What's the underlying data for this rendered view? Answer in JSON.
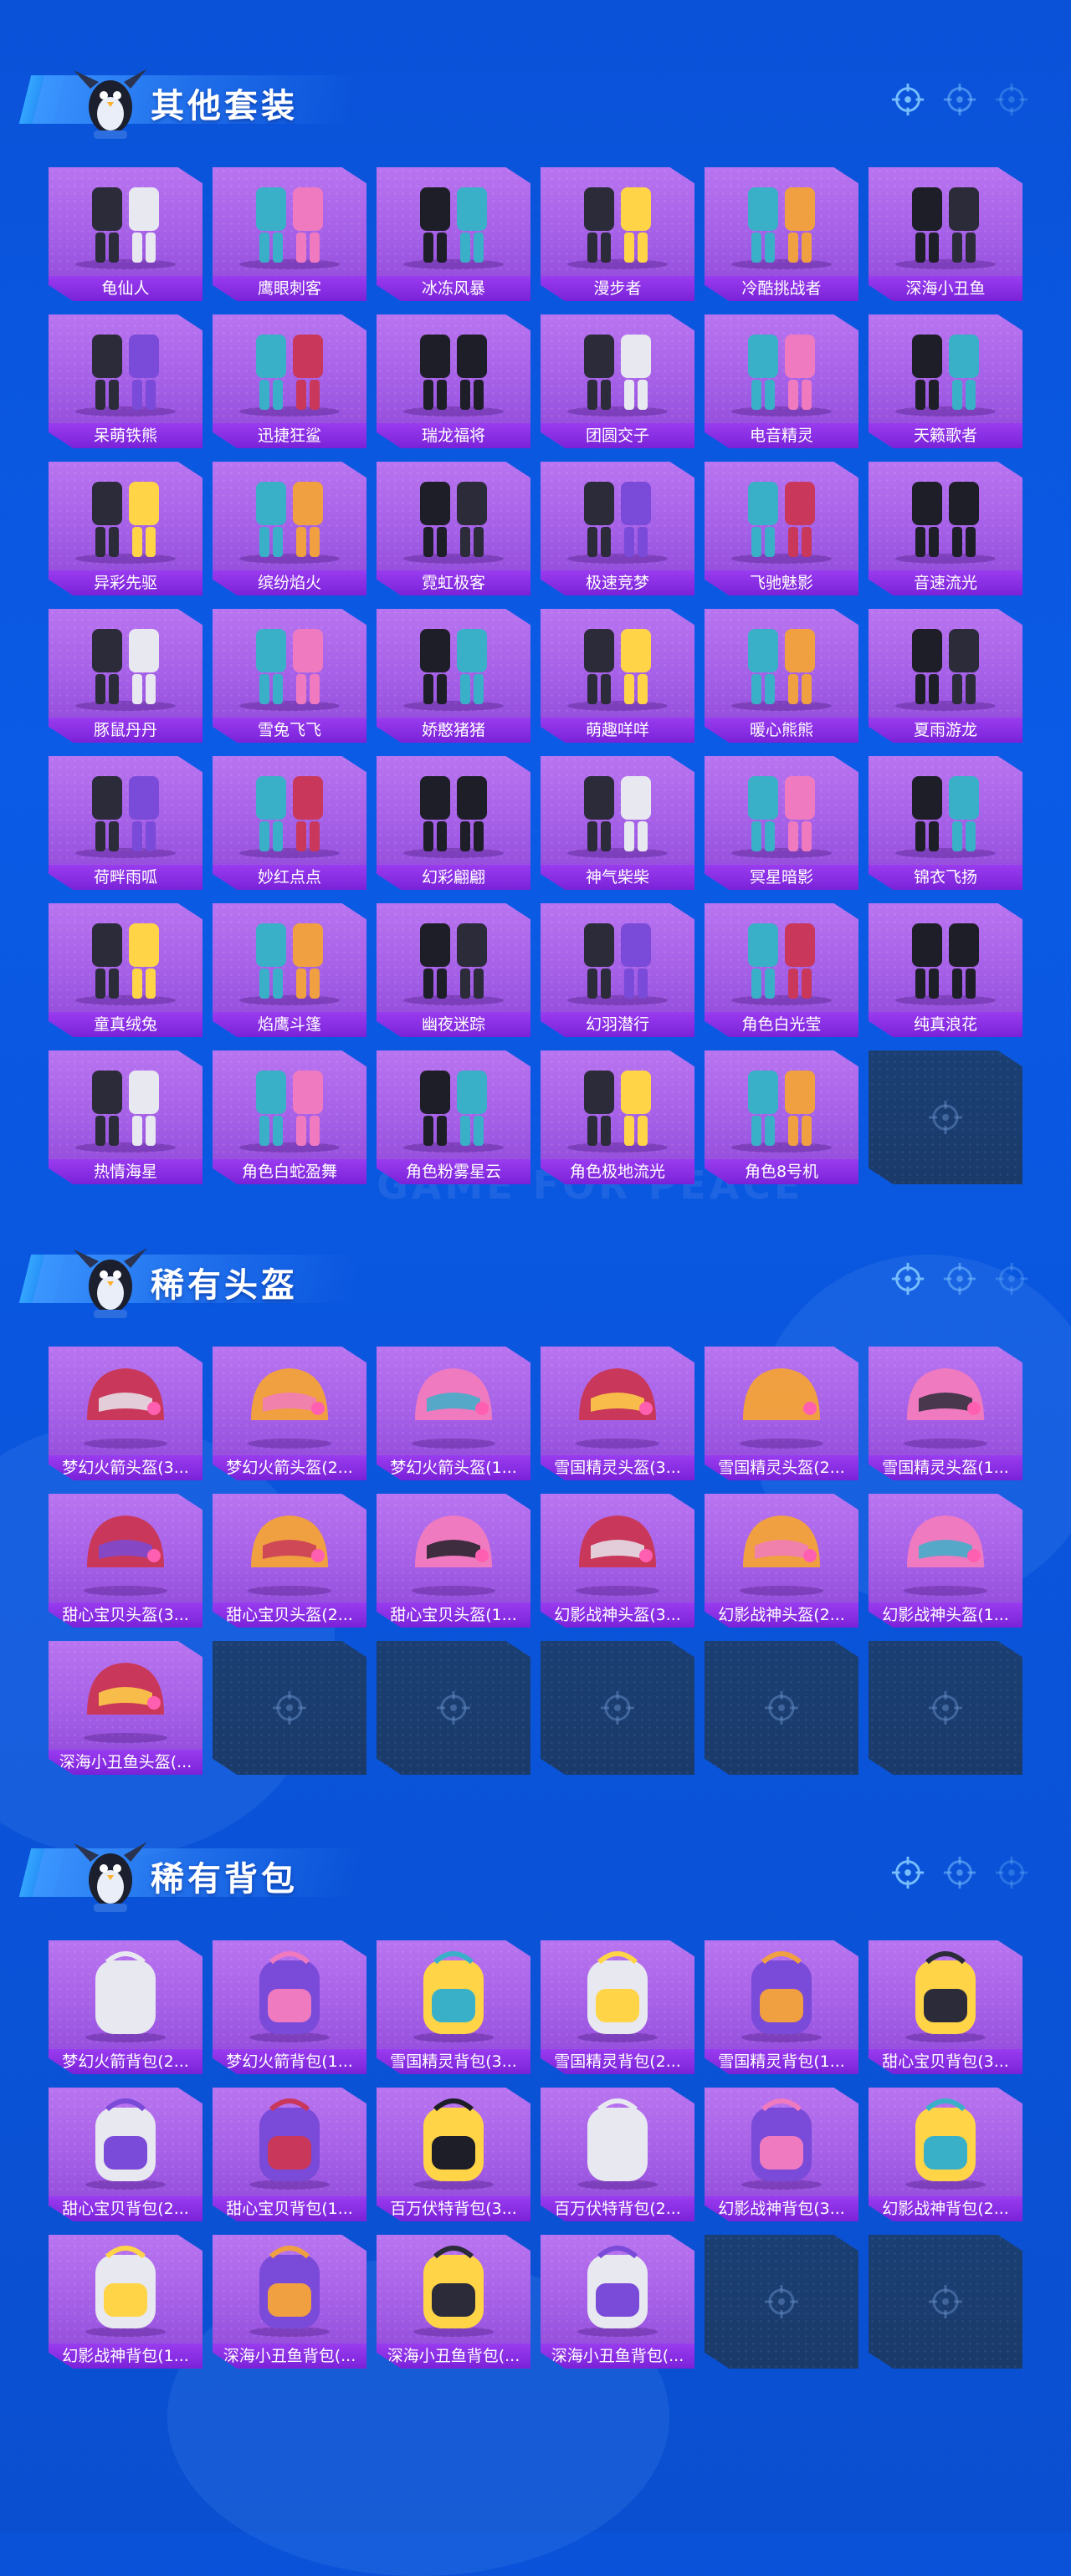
{
  "watermark": "GAME FOR PEACE",
  "sections": [
    {
      "title": "其他套装",
      "items": [
        "龟仙人",
        "鹰眼刺客",
        "冰冻风暴",
        "漫步者",
        "冷酷挑战者",
        "深海小丑鱼",
        "呆萌铁熊",
        "迅捷狂鲨",
        "瑞龙福将",
        "团圆交子",
        "电音精灵",
        "天籁歌者",
        "异彩先驱",
        "缤纷焰火",
        "霓虹极客",
        "极速竞梦",
        "飞驰魅影",
        "音速流光",
        "豚鼠丹丹",
        "雪兔飞飞",
        "娇憨猪猪",
        "萌趣咩咩",
        "暖心熊熊",
        "夏雨游龙",
        "荷畔雨呱",
        "妙红点点",
        "幻彩翩翩",
        "神气柴柴",
        "冥星暗影",
        "锦衣飞扬",
        "童真绒兔",
        "焰鹰斗篷",
        "幽夜迷踪",
        "幻羽潜行",
        "角色白光莹",
        "纯真浪花",
        "热情海星",
        "角色白蛇盈舞",
        "角色粉雾星云",
        "角色极地流光",
        "角色8号机"
      ],
      "empty_count": 1
    },
    {
      "title": "稀有头盔",
      "items": [
        "梦幻火箭头盔(3...",
        "梦幻火箭头盔(2...",
        "梦幻火箭头盔(1...",
        "雪国精灵头盔(3...",
        "雪国精灵头盔(2...",
        "雪国精灵头盔(1...",
        "甜心宝贝头盔(3...",
        "甜心宝贝头盔(2...",
        "甜心宝贝头盔(1...",
        "幻影战神头盔(3...",
        "幻影战神头盔(2...",
        "幻影战神头盔(1...",
        "深海小丑鱼头盔(..."
      ],
      "empty_count": 5
    },
    {
      "title": "稀有背包",
      "items": [
        "梦幻火箭背包(2...",
        "梦幻火箭背包(1...",
        "雪国精灵背包(3...",
        "雪国精灵背包(2...",
        "雪国精灵背包(1...",
        "甜心宝贝背包(3...",
        "甜心宝贝背包(2...",
        "甜心宝贝背包(1...",
        "百万伏特背包(3...",
        "百万伏特背包(2...",
        "幻影战神背包(3...",
        "幻影战神背包(2...",
        "幻影战神背包(1...",
        "深海小丑鱼背包(...",
        "深海小丑鱼背包(...",
        "深海小丑鱼背包(..."
      ],
      "empty_count": 2
    }
  ],
  "icons": {
    "mascot": "penguin-mascot-icon",
    "header_target": "crosshair-icon",
    "empty_slot": "crosshair-icon"
  },
  "colors": {
    "background": "#0b5be6",
    "card": "#a35ee6",
    "card_label": "#7a22d8",
    "empty_slot": "#1a3a6a"
  }
}
